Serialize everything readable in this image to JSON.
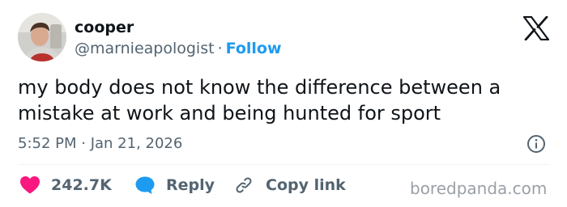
{
  "author": {
    "name": "cooper",
    "handle": "@marnieapologist",
    "separator": "·",
    "follow_label": "Follow"
  },
  "tweet": {
    "text": "my body does not know the difference between a mistake at work and being hunted for sport",
    "timestamp": "5:52 PM · Jan 21, 2026"
  },
  "actions": {
    "likes_count": "242.7K",
    "reply_label": "Reply",
    "copy_link_label": "Copy link"
  },
  "watermark": "boredpanda.com",
  "colors": {
    "accent": "#1d9bf0",
    "like": "#f91880",
    "secondary_text": "#536471",
    "primary_text": "#0f1419"
  },
  "icons": [
    "x-logo-icon",
    "info-icon",
    "heart-icon",
    "reply-bubble-icon",
    "link-icon"
  ]
}
